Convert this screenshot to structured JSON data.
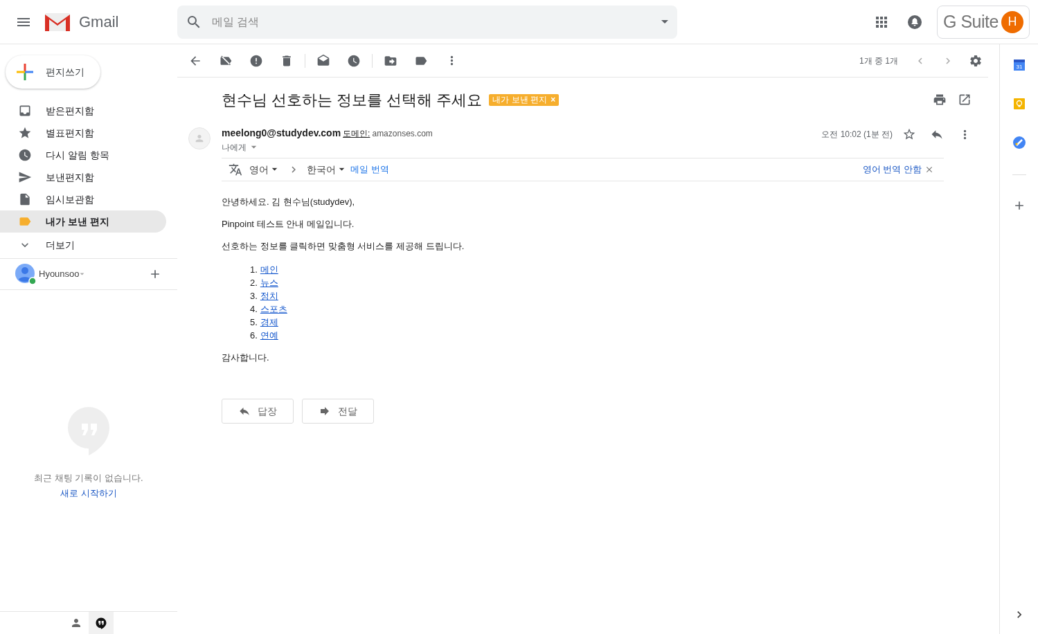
{
  "header": {
    "app_name": "Gmail",
    "search": {
      "placeholder": "메일 검색"
    },
    "brand": "G Suite",
    "avatar_letter": "H"
  },
  "sidebar": {
    "compose": "편지쓰기",
    "items": [
      {
        "kind": "inbox",
        "label": "받은편지함",
        "selected": false
      },
      {
        "kind": "starred",
        "label": "별표편지함",
        "selected": false
      },
      {
        "kind": "snoozed",
        "label": "다시 알림 항목",
        "selected": false
      },
      {
        "kind": "sent",
        "label": "보낸편지함",
        "selected": false
      },
      {
        "kind": "drafts",
        "label": "임시보관함",
        "selected": false
      },
      {
        "kind": "label",
        "label": "내가 보낸 편지",
        "selected": true
      },
      {
        "kind": "more",
        "label": "더보기",
        "selected": false
      }
    ],
    "account": "Hyounsoo",
    "chat": {
      "empty": "최근 채팅 기록이 없습니다.",
      "start": "새로 시작하기"
    },
    "bottom_tabs": [
      {
        "kind": "contacts",
        "selected": false
      },
      {
        "kind": "chat",
        "selected": true
      }
    ]
  },
  "toolbar": {
    "count": "1개 중 1개"
  },
  "message": {
    "subject": "현수님 선호하는 정보를 선택해 주세요",
    "label": "내가 보낸 편지",
    "label_close": "×",
    "sender": "meelong0@studydev.com",
    "domain_label": "도메인:",
    "domain": "amazonses.com",
    "to": "나에게",
    "time": "오전 10:02 (1분 전)",
    "starred": false,
    "translate": {
      "from": "영어",
      "to": "한국어",
      "action": "메일 번역",
      "turn_off": "영어 번역 안함"
    },
    "body": {
      "paragraphs": [
        "안녕하세요. 김 현수님(studydev),",
        "Pinpoint 테스트 안내 메일입니다.",
        "선호하는 정보를 클릭하면 맞춤형 서비스를 제공해 드립니다."
      ],
      "links": [
        {
          "number": "1.",
          "text": "메인"
        },
        {
          "number": "2.",
          "text": "뉴스"
        },
        {
          "number": "3.",
          "text": "정치"
        },
        {
          "number": "4.",
          "text": "스포츠"
        },
        {
          "number": "5.",
          "text": "경제"
        },
        {
          "number": "6.",
          "text": "연예"
        }
      ],
      "closing": "감사합니다."
    },
    "actions": [
      {
        "kind": "reply",
        "label": "답장"
      },
      {
        "kind": "forward",
        "label": "전달"
      }
    ]
  },
  "side_panel": {
    "calendar_day": "31"
  }
}
